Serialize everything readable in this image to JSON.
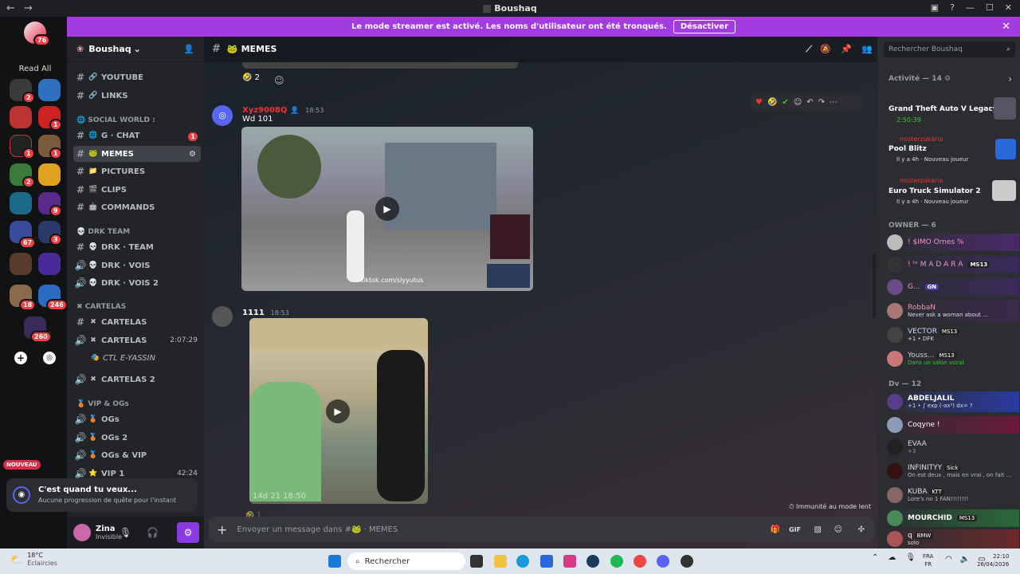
{
  "window": {
    "title": "Boushaq"
  },
  "banner": {
    "text": "Le mode streamer est activé. Les noms d'utilisateur ont été tronqués.",
    "button": "Désactiver"
  },
  "rail": {
    "dm_badge": "76",
    "read_all": "Read All",
    "badges": [
      "2",
      "1",
      "1",
      "1",
      "2",
      "9",
      "2",
      "67",
      "3",
      "18",
      "246",
      "260"
    ]
  },
  "server": {
    "name": "Boushaq"
  },
  "channels": {
    "top": [
      {
        "label": "YOUTUBE"
      },
      {
        "label": "LINKS"
      }
    ],
    "cat_social": "SOCIAL WORLD :",
    "social": [
      {
        "label": "G · CHAT",
        "badge": "1"
      },
      {
        "label": "MEMES"
      },
      {
        "label": "PICTURES"
      },
      {
        "label": "CLIPS"
      },
      {
        "label": "COMMANDS"
      }
    ],
    "cat_drk": "DRK TEAM",
    "drk": [
      {
        "label": "DRK · TEAM"
      },
      {
        "label": "DRK · VOIS"
      },
      {
        "label": "DRK · VOIS 2"
      }
    ],
    "cat_cartelas": "CARTELAS",
    "cartelas": [
      {
        "label": "CARTELAS"
      },
      {
        "label": "CARTELAS",
        "time": "2:07:29"
      },
      {
        "label": "CTL E-YASSIN"
      },
      {
        "label": "CARTELAS 2"
      }
    ],
    "cat_vip": "VIP & OGs",
    "vip": [
      {
        "label": "OGs"
      },
      {
        "label": "OGs 2"
      },
      {
        "label": "OGs & VIP"
      },
      {
        "label": "VIP 1",
        "time": "42:24"
      }
    ]
  },
  "quest": {
    "tag": "NOUVEAU",
    "title": "C'est quand tu veux...",
    "sub": "Aucune progression de quête pour l'instant"
  },
  "user": {
    "name": "Zina",
    "status": "Invisible"
  },
  "chat": {
    "channel": "MEMES",
    "reaction_count": "2",
    "msg1": {
      "author": "Xyz9008Q",
      "time": "18:53",
      "text": "Wd 101",
      "overlay": "tiktok.com/slyyutus"
    },
    "msg2": {
      "author": "1111",
      "time": "18:53",
      "overlay": "14d 21 18:50"
    },
    "placeholder": "Envoyer un message dans #",
    "placeholder_channel": "MEMES",
    "immunity": "Immunité au mode lent",
    "reaction2_count": "1"
  },
  "members": {
    "search": "Rechercher Boushaq",
    "activity_header": "Activité — 14",
    "activities": [
      {
        "title": "Grand Theft Auto V Legacy",
        "sub": "2:50:39"
      },
      {
        "user": "misterzakaria",
        "title": "Pool Blitz",
        "sub": "Il y a 4h",
        "extra": "Nouveau joueur"
      },
      {
        "user": "misterzakaria",
        "title": "Euro Truck Simulator 2",
        "sub": "Il y a 4h",
        "extra": "Nouveau joueur"
      }
    ],
    "owner_header": "OWNER — 6",
    "owners": [
      {
        "name": "! $IMO Ornes %"
      },
      {
        "name": "! ᵗᵉ M A D A R A",
        "tag": "MS13"
      },
      {
        "name": "G...",
        "tag": "GN"
      },
      {
        "name": "RobbaN",
        "sub": "Never ask a woman about ..."
      },
      {
        "name": "VECTOR",
        "tag": "MS13",
        "sub": "+1 • DFK"
      },
      {
        "name": "Youss...",
        "tag": "MS13",
        "sub": "Dans un salon vocal"
      }
    ],
    "dv_header": "Dv — 12",
    "dv": [
      {
        "name": "ABDELJALIL",
        "sub": "+1 • ∫ exp (-ax²) dx= ?"
      },
      {
        "name": "Coqyne !"
      },
      {
        "name": "EVAA",
        "sub": "+3"
      },
      {
        "name": "INFINITYY",
        "tag": "Sick",
        "sub": "On est deux , mais en vrai , on fait ..."
      },
      {
        "name": "KUBA",
        "tag": "KTT",
        "sub": "Lore's no 1 FAN!!!!!!!!"
      },
      {
        "name": "MOURCHID",
        "tag": "MS13"
      },
      {
        "name": "q",
        "tag": "BMW",
        "sub": "solo"
      }
    ]
  },
  "taskbar": {
    "weather_temp": "18°C",
    "weather_desc": "Éclaircies",
    "search": "Rechercher",
    "lang1": "FRA",
    "lang2": "FR",
    "time": "22:10",
    "date": "26/04/2026"
  }
}
